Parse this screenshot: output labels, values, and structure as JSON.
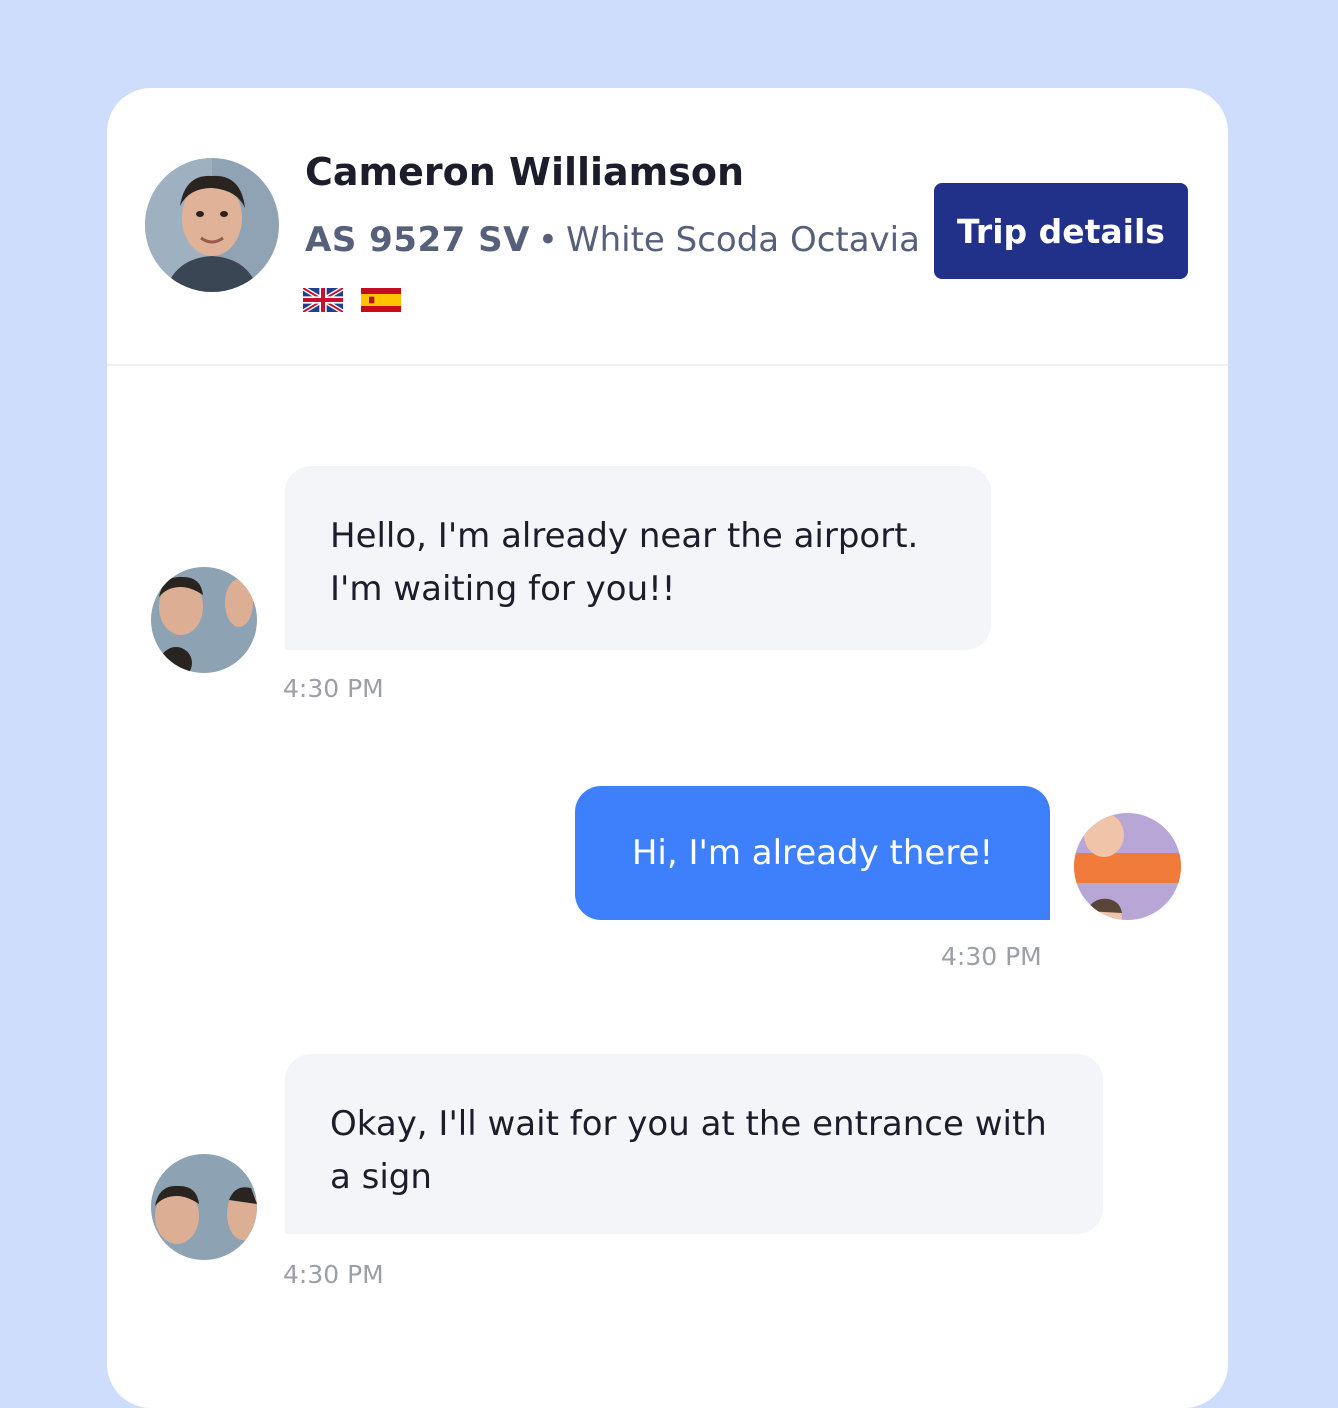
{
  "header": {
    "driver_name": "Cameron Williamson",
    "plate": "AS 9527 SV",
    "separator": "•",
    "car": "White Scoda Octavia",
    "languages": [
      "English",
      "Spanish"
    ],
    "trip_button_label": "Trip details"
  },
  "messages": [
    {
      "direction": "incoming",
      "lines": [
        "Hello, I'm already near the airport.",
        "I'm waiting for you!!"
      ],
      "time": "4:30 PM"
    },
    {
      "direction": "outgoing",
      "lines": [
        "Hi, I'm already there!"
      ],
      "time": "4:30 PM"
    },
    {
      "direction": "incoming",
      "lines": [
        "Okay, I'll wait for you at the entrance with",
        "a sign"
      ],
      "time": "4:30 PM"
    }
  ],
  "colors": {
    "page_background": "#cfddfd",
    "card": "#ffffff",
    "trip_button": "#213089",
    "outgoing_bubble": "#3e7ffb",
    "incoming_bubble": "#f4f5f9",
    "timestamp": "#9b9fa8"
  }
}
